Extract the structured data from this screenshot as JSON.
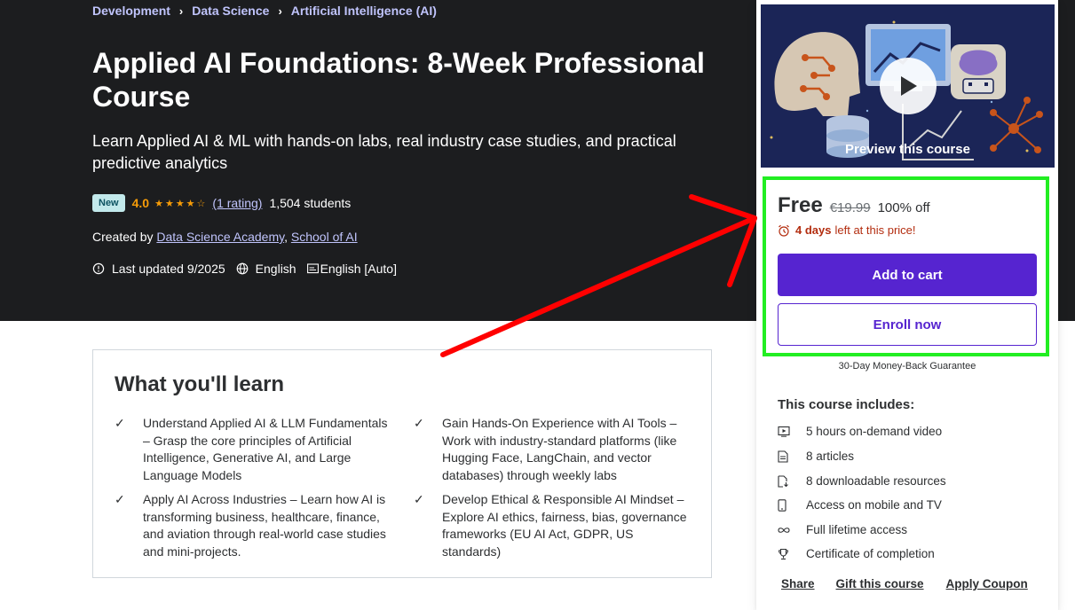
{
  "breadcrumb": [
    "Development",
    "Data Science",
    "Artificial Intelligence (AI)"
  ],
  "course": {
    "title": "Applied AI Foundations: 8-Week Professional Course",
    "subtitle": "Learn Applied AI & ML with hands-on labs, real industry case studies, and practical predictive analytics",
    "badge": "New",
    "rating": "4.0",
    "stars_filled": 4,
    "rating_link": "(1 rating)",
    "students": "1,504 students",
    "created_by_label": "Created by",
    "authors": [
      "Data Science Academy",
      "School of AI"
    ],
    "author_sep": ",",
    "last_updated": "Last updated 9/2025",
    "language": "English",
    "captions": "English [Auto]"
  },
  "learn": {
    "title": "What you'll learn",
    "items": [
      "Understand Applied AI & LLM Fundamentals – Grasp the core principles of Artificial Intelligence, Generative AI, and Large Language Models",
      "Gain Hands-On Experience with AI Tools – Work with industry-standard platforms (like Hugging Face, LangChain, and vector databases) through weekly labs",
      "Apply AI Across Industries – Learn how AI is transforming business, healthcare, finance, and aviation through real-world case studies and mini-projects.",
      "Develop Ethical & Responsible AI Mindset – Explore AI ethics, fairness, bias, governance frameworks (EU AI Act, GDPR, US standards)"
    ]
  },
  "sidebar": {
    "preview_label": "Preview this course",
    "price": "Free",
    "original_price": "€19.99",
    "discount": "100% off",
    "timer_bold": "4 days",
    "timer_rest": "left at this price!",
    "add_to_cart": "Add to cart",
    "enroll_now": "Enroll now",
    "guarantee": "30-Day Money-Back Guarantee",
    "includes_title": "This course includes:",
    "includes": [
      {
        "icon": "video-icon",
        "label": "5 hours on-demand video"
      },
      {
        "icon": "article-icon",
        "label": "8 articles"
      },
      {
        "icon": "download-file-icon",
        "label": "8 downloadable resources"
      },
      {
        "icon": "mobile-icon",
        "label": "Access on mobile and TV"
      },
      {
        "icon": "infinity-icon",
        "label": "Full lifetime access"
      },
      {
        "icon": "trophy-icon",
        "label": "Certificate of completion"
      }
    ],
    "links": [
      "Share",
      "Gift this course",
      "Apply Coupon"
    ]
  },
  "colors": {
    "hero_bg": "#1c1d1f",
    "link_purple": "#c0c4fc",
    "rating_orange": "#f69c08",
    "brand_purple": "#5624d0",
    "timer_red": "#b32d0f",
    "annotation_red": "#ff0000",
    "highlight_green": "#22ee22"
  }
}
